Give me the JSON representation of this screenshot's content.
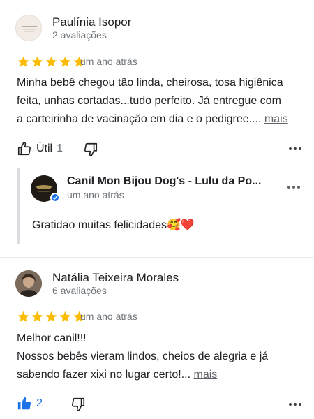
{
  "reviews": [
    {
      "author": "Paulínia Isopor",
      "review_count": "2 avaliações",
      "rating": 5,
      "time": "um ano atrás",
      "text_lines": [
        "Minha bebê chegou tão linda, cheirosa, tosa higiênica",
        "feita, unhas cortadas...tudo perfeito. Já entregue com",
        "a carteirinha de vacinação em dia e o pedigree...."
      ],
      "more_label": "mais",
      "helpful_label": "Útil",
      "helpful_count": "1",
      "reply": {
        "owner_name": "Canil Mon Bijou Dog's - Lulu da Po...",
        "time": "um ano atrás",
        "text": "Gratidao muitas felicidades🥰❤️"
      }
    },
    {
      "author": "Natália Teixeira Morales",
      "review_count": "6 avaliações",
      "rating": 5,
      "time": "um ano atrás",
      "text_lines": [
        "Melhor canil!!!",
        "Nossos bebês vieram lindos, cheios de alegria e já",
        "sabendo fazer xixi no lugar certo!..."
      ],
      "more_label": "mais",
      "liked_count": "2"
    }
  ],
  "colors": {
    "star": "#fbbc04",
    "like_active": "#1a73e8",
    "verified": "#1a73e8",
    "muted": "#70757a"
  },
  "icons": [
    "thumbs-up-icon",
    "thumbs-down-icon",
    "more-options-icon",
    "star-icon",
    "verified-icon"
  ]
}
